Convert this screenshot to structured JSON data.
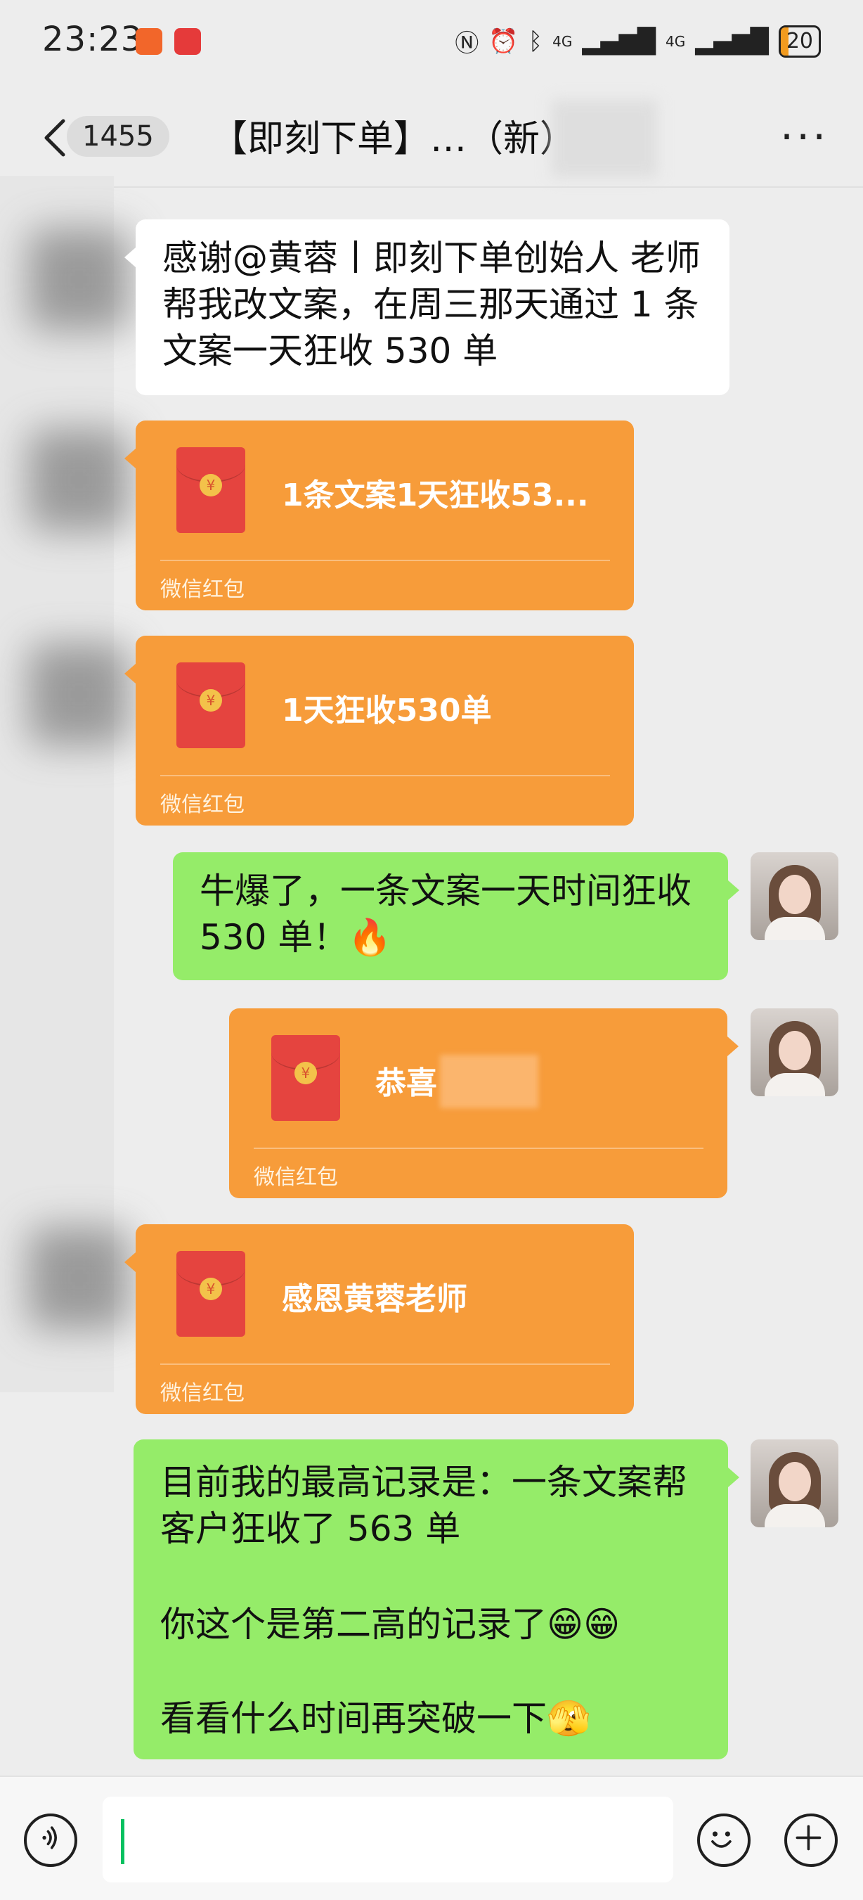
{
  "status_bar": {
    "time": "23:23",
    "battery": "20",
    "network_labels": [
      "4G",
      "4G"
    ],
    "icons": [
      "app-icon-orange",
      "app-icon-red",
      "nfc-icon",
      "alarm-icon",
      "bluetooth-icon",
      "signal-icon",
      "signal-icon",
      "battery-icon"
    ]
  },
  "nav": {
    "unread_count": "1455",
    "chat_title": "【即刻下单】…（新）"
  },
  "messages": [
    {
      "type": "text",
      "side": "left",
      "text": "感谢@黄蓉丨即刻下单创始人  老师帮我改文案，在周三那天通过 1 条文案一天狂收 530 单"
    },
    {
      "type": "red_packet",
      "side": "left",
      "title": "1条文案1天狂收53...",
      "footer": "微信红包"
    },
    {
      "type": "red_packet",
      "side": "left",
      "title": "1天狂收530单",
      "footer": "微信红包"
    },
    {
      "type": "text",
      "side": "right",
      "text": "牛爆了，一条文案一天时间狂收 530 单！🔥"
    },
    {
      "type": "red_packet",
      "side": "right",
      "title": "恭喜",
      "footer": "微信红包"
    },
    {
      "type": "red_packet",
      "side": "left",
      "title": "感恩黄蓉老师",
      "footer": "微信红包"
    },
    {
      "type": "text",
      "side": "right",
      "lines": [
        "目前我的最高记录是：一条文案帮客户狂收了 563 单",
        "你这个是第二高的记录了😁😁",
        "看看什么时间再突破一下🫣"
      ]
    }
  ],
  "input_bar": {
    "placeholder": "",
    "icons": [
      "voice-icon",
      "emoji-icon",
      "plus-icon"
    ]
  },
  "colors": {
    "background": "#ededed",
    "green_bubble": "#95ec69",
    "red_packet": "#f79c3a",
    "envelope": "#e5443f"
  }
}
